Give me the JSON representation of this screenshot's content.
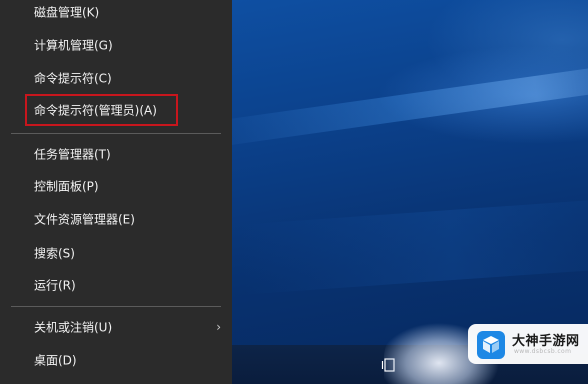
{
  "menu": {
    "items": [
      {
        "label": "磁盘管理(K)"
      },
      {
        "label": "计算机管理(G)"
      },
      {
        "label": "命令提示符(C)"
      },
      {
        "label": "命令提示符(管理员)(A)"
      },
      {
        "label": "任务管理器(T)"
      },
      {
        "label": "控制面板(P)"
      },
      {
        "label": "文件资源管理器(E)"
      },
      {
        "label": "搜索(S)"
      },
      {
        "label": "运行(R)"
      },
      {
        "label": "关机或注销(U)",
        "arrow": "›"
      },
      {
        "label": "桌面(D)"
      }
    ],
    "highlighted_item": "命令提示符(管理员)(A)",
    "highlight_color": "#c8161d"
  },
  "watermark": {
    "title": "大神手游网",
    "url": "www.dsbcsb.com",
    "brand_color": "#1e88e5"
  },
  "colors": {
    "menu_bg": "#2b2b2b",
    "menu_text": "#f2f2f2",
    "desktop_blue": "#0b3f88"
  }
}
